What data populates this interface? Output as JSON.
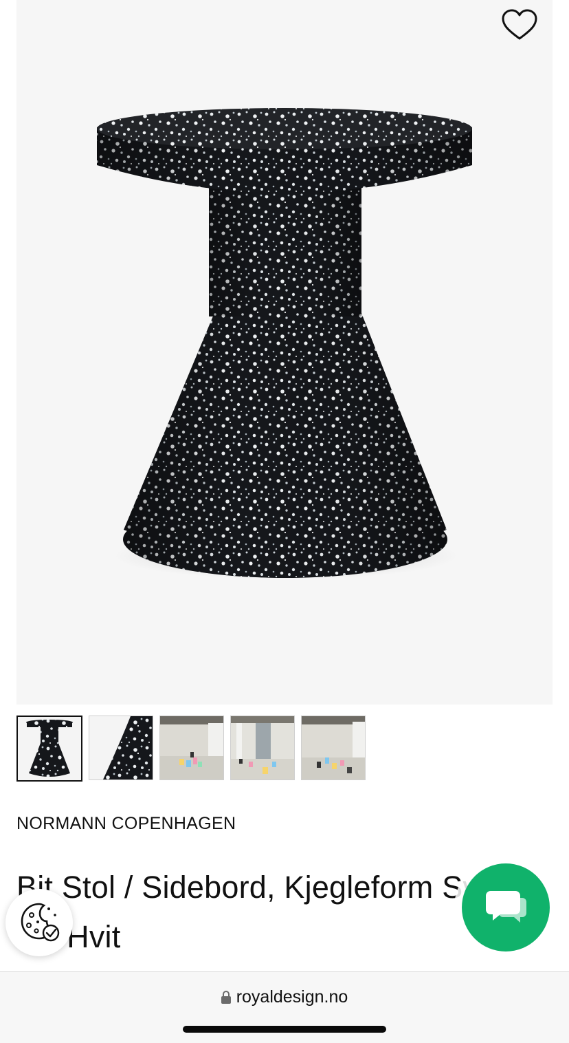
{
  "product": {
    "brand": "NORMANN COPENHAGEN",
    "title": "Bit Stol / Sidebord, Kjegleform Svart Og Hvit",
    "wishlist_icon": "heart-outline-icon"
  },
  "gallery": {
    "active_index": 0,
    "thumbnails": [
      {
        "name": "thumb-stool-front"
      },
      {
        "name": "thumb-stool-detail"
      },
      {
        "name": "thumb-room-scene-1"
      },
      {
        "name": "thumb-room-scene-2"
      },
      {
        "name": "thumb-room-scene-3"
      }
    ]
  },
  "widgets": {
    "cookie_icon": "cookie-consent-icon",
    "chat_icon": "chat-bubbles-icon",
    "chat_color": "#10b26b"
  },
  "browser": {
    "url": "royaldesign.no",
    "lock_icon": "lock-icon"
  }
}
